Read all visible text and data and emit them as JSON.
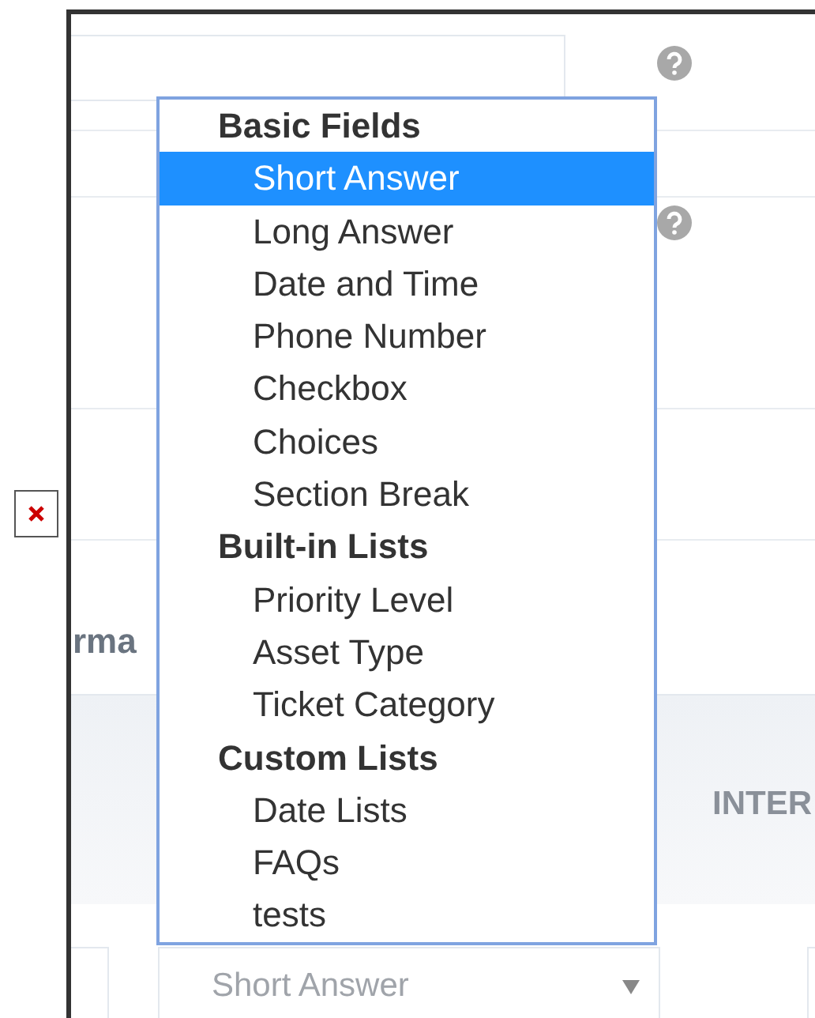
{
  "background": {
    "section_heading": "rma",
    "column_heading": "INTER",
    "field_type_select": {
      "value": "Short Answer"
    }
  },
  "dropdown": {
    "groups": [
      {
        "label": "Basic Fields",
        "items": [
          {
            "label": "Short Answer",
            "selected": true
          },
          {
            "label": "Long Answer",
            "selected": false
          },
          {
            "label": "Date and Time",
            "selected": false
          },
          {
            "label": "Phone Number",
            "selected": false
          },
          {
            "label": "Checkbox",
            "selected": false
          },
          {
            "label": "Choices",
            "selected": false
          },
          {
            "label": "Section Break",
            "selected": false
          }
        ]
      },
      {
        "label": "Built-in Lists",
        "items": [
          {
            "label": "Priority Level",
            "selected": false
          },
          {
            "label": "Asset Type",
            "selected": false
          },
          {
            "label": "Ticket Category",
            "selected": false
          }
        ]
      },
      {
        "label": "Custom Lists",
        "items": [
          {
            "label": "Date Lists",
            "selected": false
          },
          {
            "label": "FAQs",
            "selected": false
          },
          {
            "label": "tests",
            "selected": false
          }
        ]
      }
    ]
  }
}
